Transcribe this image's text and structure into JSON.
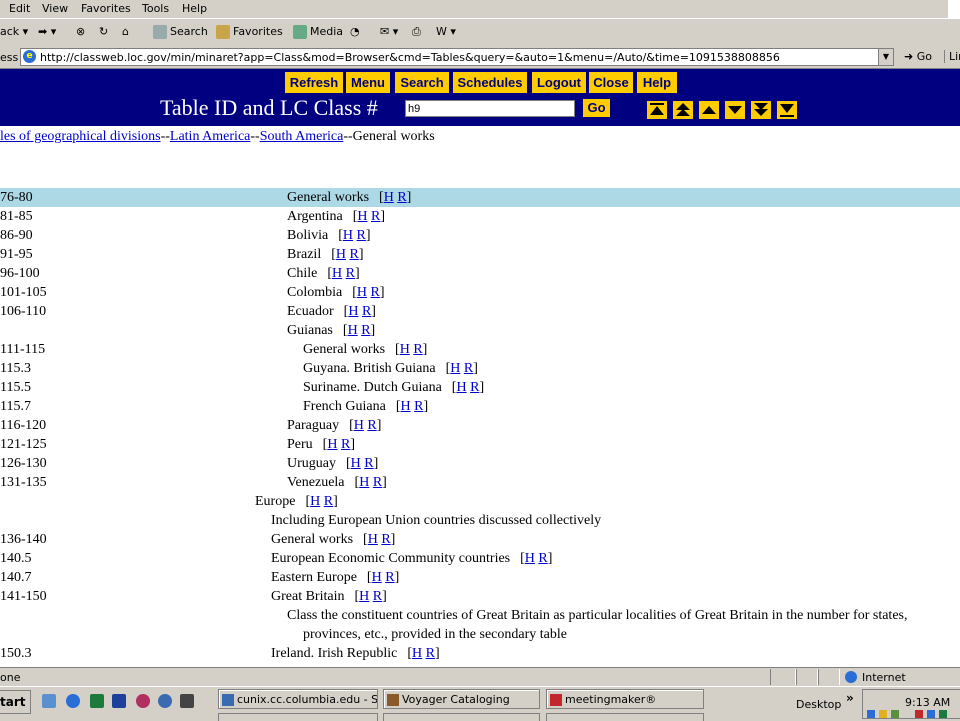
{
  "menu": {
    "items": [
      "Edit",
      "View",
      "Favorites",
      "Tools",
      "Help"
    ]
  },
  "toolbar": {
    "back": "ack",
    "search": "Search",
    "favorites": "Favorites",
    "media": "Media"
  },
  "address": {
    "label": "ess",
    "url": "http://classweb.loc.gov/min/minaret?app=Class&mod=Browser&cmd=Tables&query=&auto=1&menu=/Auto/&time=1091538808856",
    "go": "Go",
    "links": "Lin"
  },
  "nav": {
    "buttons": [
      "Refresh",
      "Menu",
      "Search",
      "Schedules",
      "Logout",
      "Close",
      "Help"
    ]
  },
  "form": {
    "title": "Table ID and LC Class #",
    "value": "h9",
    "go": "Go"
  },
  "breadcrumb": {
    "link1": "les of geographical divisions",
    "sep": "--",
    "link2": "Latin America",
    "link3": "South America",
    "current": "General works"
  },
  "hr": {
    "h": "H",
    "r": "R"
  },
  "rows": [
    {
      "num": "76-80",
      "caption": "General works",
      "indent": 287,
      "links": true,
      "highlight": true
    },
    {
      "num": "81-85",
      "caption": "Argentina",
      "indent": 287,
      "links": true
    },
    {
      "num": "86-90",
      "caption": "Bolivia",
      "indent": 287,
      "links": true
    },
    {
      "num": "91-95",
      "caption": "Brazil",
      "indent": 287,
      "links": true
    },
    {
      "num": "96-100",
      "caption": "Chile",
      "indent": 287,
      "links": true
    },
    {
      "num": "101-105",
      "caption": "Colombia",
      "indent": 287,
      "links": true
    },
    {
      "num": "106-110",
      "caption": "Ecuador",
      "indent": 287,
      "links": true
    },
    {
      "num": "",
      "caption": "Guianas",
      "indent": 287,
      "links": true
    },
    {
      "num": "111-115",
      "caption": "General works",
      "indent": 303,
      "links": true
    },
    {
      "num": "115.3",
      "caption": "Guyana. British Guiana",
      "indent": 303,
      "links": true
    },
    {
      "num": "115.5",
      "caption": "Suriname. Dutch Guiana",
      "indent": 303,
      "links": true
    },
    {
      "num": "115.7",
      "caption": "French Guiana",
      "indent": 303,
      "links": true
    },
    {
      "num": "116-120",
      "caption": "Paraguay",
      "indent": 287,
      "links": true
    },
    {
      "num": "121-125",
      "caption": "Peru",
      "indent": 287,
      "links": true
    },
    {
      "num": "126-130",
      "caption": "Uruguay",
      "indent": 287,
      "links": true
    },
    {
      "num": "131-135",
      "caption": "Venezuela",
      "indent": 287,
      "links": true
    },
    {
      "num": "",
      "caption": "Europe",
      "indent": 255,
      "links": true
    },
    {
      "num": "",
      "caption": "Including European Union countries discussed collectively",
      "indent": 271,
      "links": false
    },
    {
      "num": "136-140",
      "caption": "General works",
      "indent": 271,
      "links": true
    },
    {
      "num": "140.5",
      "caption": "European Economic Community countries",
      "indent": 271,
      "links": true
    },
    {
      "num": "140.7",
      "caption": "Eastern Europe",
      "indent": 271,
      "links": true
    },
    {
      "num": "141-150",
      "caption": "Great Britain",
      "indent": 271,
      "links": true
    },
    {
      "num": "",
      "caption": "Class the constituent countries of Great Britain as particular localities of Great Britain in the number for states,",
      "indent": 287,
      "links": false
    },
    {
      "num": "",
      "caption": "provinces, etc., provided in the secondary table",
      "indent": 303,
      "links": false
    },
    {
      "num": "150.3",
      "caption": "Ireland. Irish Republic",
      "indent": 271,
      "links": true
    }
  ],
  "status": {
    "text": "one",
    "zone": "Internet"
  },
  "taskbar": {
    "start": "tart",
    "tasks": [
      "cunix.cc.columbia.edu - S...",
      "Voyager Cataloging",
      "meetingmaker®"
    ],
    "desktop": "Desktop",
    "chevron": "»",
    "clock": "9:13 AM"
  }
}
